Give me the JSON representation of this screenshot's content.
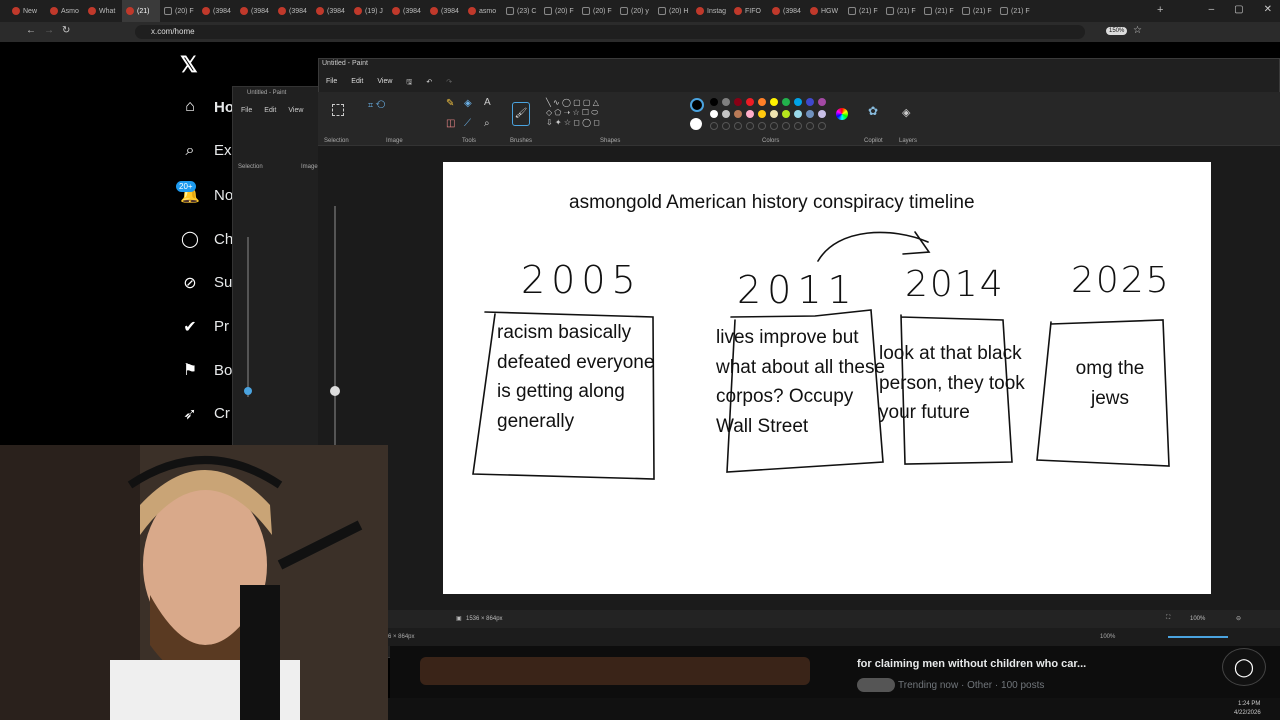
{
  "browser": {
    "tabs": [
      "New",
      "Asmo",
      "What",
      "(21)",
      "(20) F",
      "(3984",
      "(3984",
      "(3984",
      "(3984",
      "(19) J",
      "(3984",
      "(3984",
      "asmo",
      "(23) C",
      "(20) F",
      "(20) F",
      "(20) y",
      "(20) H",
      "Instag",
      "FIFO",
      "(3984",
      "HGW",
      "(21) F",
      "(21) F",
      "(21) F",
      "(21) F",
      "(21) F"
    ],
    "url": "x.com/home",
    "zoom": "150%"
  },
  "x_sidebar": {
    "items": [
      {
        "icon": "home-icon",
        "label": "Ho"
      },
      {
        "icon": "search-icon",
        "label": "Ex"
      },
      {
        "icon": "bell-icon",
        "label": "No",
        "badge": "20+"
      },
      {
        "icon": "chat-icon",
        "label": "Ch"
      },
      {
        "icon": "grok-icon",
        "label": "Su"
      },
      {
        "icon": "verified-icon",
        "label": "Pr"
      },
      {
        "icon": "bookmark-icon",
        "label": "Bo"
      },
      {
        "icon": "rocket-icon",
        "label": "Cr"
      }
    ]
  },
  "paint": {
    "title": "Untitled - Paint",
    "back_title": "Untitled - Paint",
    "menu": [
      "File",
      "Edit",
      "View"
    ],
    "groups": [
      "Selection",
      "Image",
      "Tools",
      "Brushes",
      "Shapes",
      "Colors",
      "Copilot",
      "Layers"
    ],
    "status_size": "1536 × 864px",
    "zoom": "100%",
    "back_status": "6 × 864px",
    "colors": [
      "#000000",
      "#7f7f7f",
      "#880015",
      "#ed1c24",
      "#ff7f27",
      "#fff200",
      "#22b14c",
      "#00a2e8",
      "#3f48cc",
      "#a349a4",
      "#ffffff",
      "#c3c3c3",
      "#b97a57",
      "#ffaec9",
      "#ffc90e",
      "#efe4b0",
      "#b5e61d",
      "#99d9ea",
      "#7092be",
      "#c8bfe7"
    ]
  },
  "drawing": {
    "title": "asmongold American history conspiracy timeline",
    "years": [
      "2005",
      "2011",
      "2014",
      "2025"
    ],
    "notes": [
      "racism basically defeated everyone is getting along generally",
      "lives improve but what about all these corpos? Occupy Wall Street",
      "look at that black person, they took your future",
      "omg the jews"
    ]
  },
  "trending": {
    "title": "for claiming men without children who car...",
    "meta": "Trending now · Other · 100 posts"
  },
  "taskbar": {
    "time": "1:24 PM",
    "date": "4/22/2026"
  }
}
